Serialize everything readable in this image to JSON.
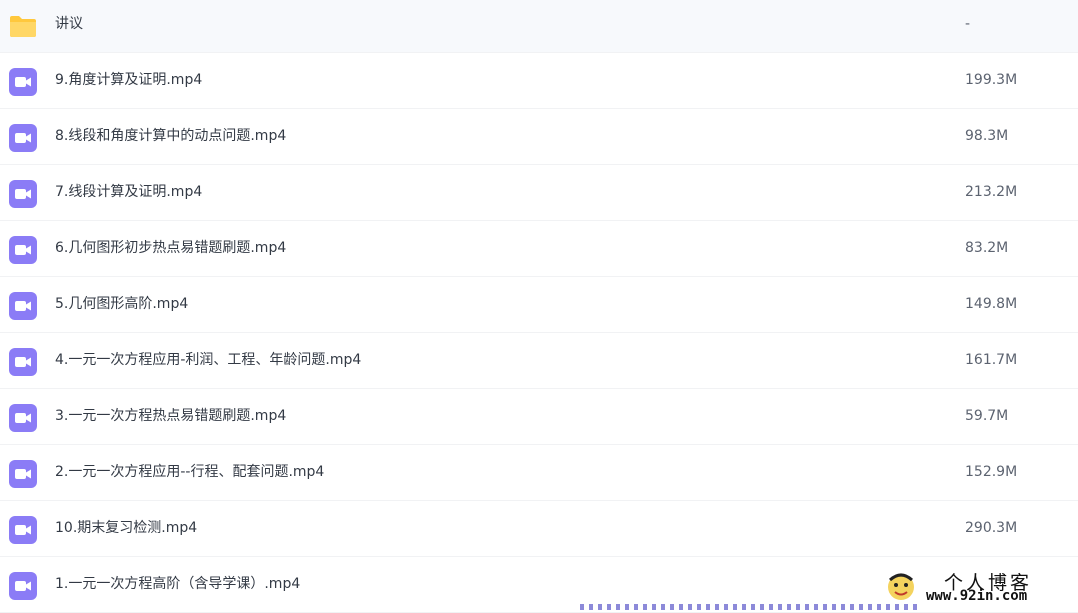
{
  "files": [
    {
      "name": "讲议",
      "size": "-",
      "type": "folder"
    },
    {
      "name": "9.角度计算及证明.mp4",
      "size": "199.3M",
      "type": "video"
    },
    {
      "name": "8.线段和角度计算中的动点问题.mp4",
      "size": "98.3M",
      "type": "video"
    },
    {
      "name": "7.线段计算及证明.mp4",
      "size": "213.2M",
      "type": "video"
    },
    {
      "name": "6.几何图形初步热点易错题刷题.mp4",
      "size": "83.2M",
      "type": "video"
    },
    {
      "name": "5.几何图形高阶.mp4",
      "size": "149.8M",
      "type": "video"
    },
    {
      "name": "4.一元一次方程应用-利润、工程、年龄问题.mp4",
      "size": "161.7M",
      "type": "video"
    },
    {
      "name": "3.一元一次方程热点易错题刷题.mp4",
      "size": "59.7M",
      "type": "video"
    },
    {
      "name": "2.一元一次方程应用--行程、配套问题.mp4",
      "size": "152.9M",
      "type": "video"
    },
    {
      "name": "10.期末复习检测.mp4",
      "size": "290.3M",
      "type": "video"
    },
    {
      "name": "1.一元一次方程高阶（含导学课）.mp4",
      "size": "",
      "type": "video"
    }
  ],
  "icons": {
    "folder": "folder-icon",
    "video": "video-file-icon"
  },
  "colors": {
    "folder": "#ffc83d",
    "video": "#8b7cf6"
  },
  "watermark": {
    "title": "个人博客",
    "url": "www.92in.com"
  }
}
